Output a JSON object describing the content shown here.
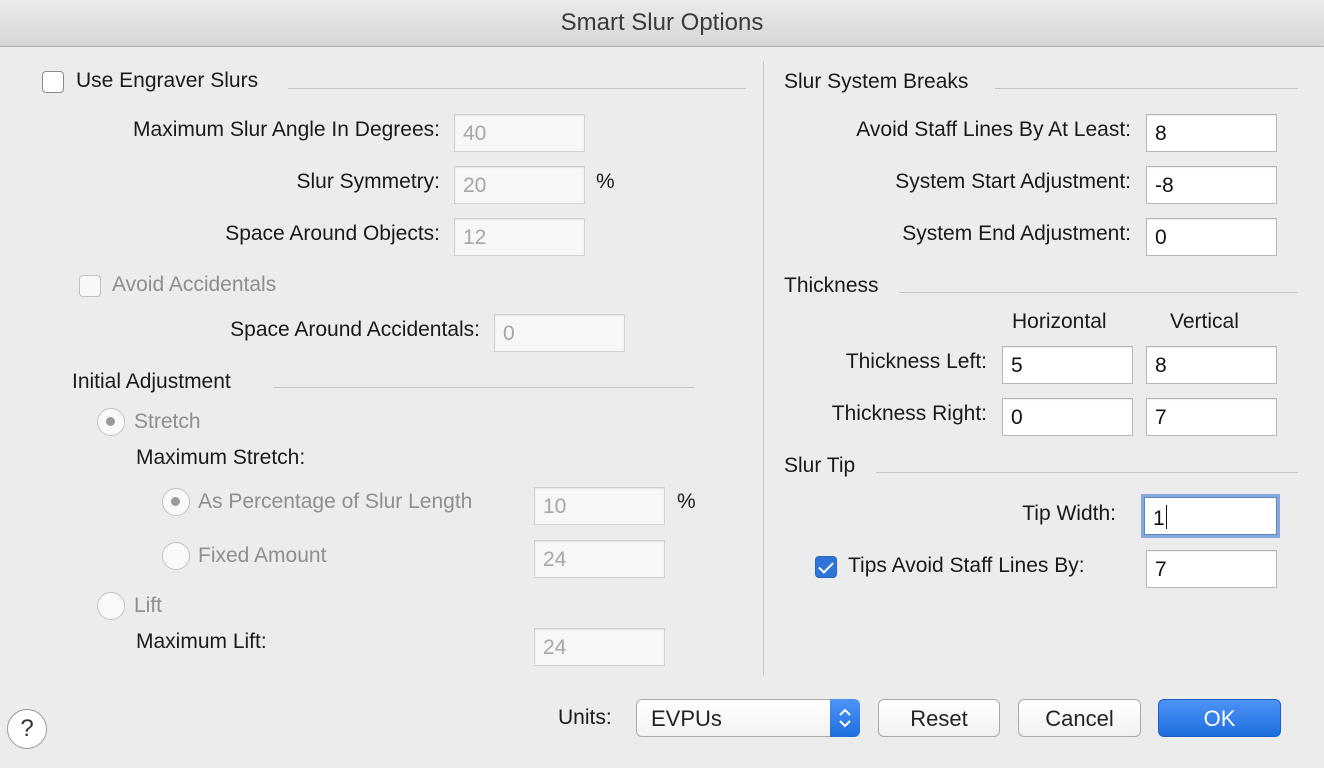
{
  "window": {
    "title": "Smart Slur Options"
  },
  "left": {
    "use_engraver": {
      "label": "Use Engraver Slurs",
      "checked": false
    },
    "max_angle": {
      "label": "Maximum Slur Angle In Degrees:",
      "value": "40"
    },
    "symmetry": {
      "label": "Slur Symmetry:",
      "value": "20",
      "unit": "%"
    },
    "space_objects": {
      "label": "Space Around Objects:",
      "value": "12"
    },
    "avoid_accidentals": {
      "label": "Avoid Accidentals",
      "checked": false
    },
    "space_accidentals": {
      "label": "Space Around Accidentals:",
      "value": "0"
    },
    "initial_adjustment": {
      "heading": "Initial Adjustment",
      "stretch": {
        "label": "Stretch",
        "selected": true
      },
      "max_stretch_label": "Maximum Stretch:",
      "as_percentage": {
        "label": "As Percentage of Slur Length",
        "value": "10",
        "unit": "%",
        "selected": true
      },
      "fixed_amount": {
        "label": "Fixed Amount",
        "value": "24",
        "selected": false
      },
      "lift": {
        "label": "Lift",
        "selected": false
      },
      "max_lift": {
        "label": "Maximum Lift:",
        "value": "24"
      }
    }
  },
  "right": {
    "system_breaks": {
      "heading": "Slur System Breaks",
      "avoid_staff": {
        "label": "Avoid Staff Lines By At Least:",
        "value": "8"
      },
      "start_adj": {
        "label": "System Start Adjustment:",
        "value": "-8"
      },
      "end_adj": {
        "label": "System End Adjustment:",
        "value": "0"
      }
    },
    "thickness": {
      "heading": "Thickness",
      "col_horizontal": "Horizontal",
      "col_vertical": "Vertical",
      "left": {
        "label": "Thickness Left:",
        "horizontal": "5",
        "vertical": "8"
      },
      "right": {
        "label": "Thickness Right:",
        "horizontal": "0",
        "vertical": "7"
      }
    },
    "slur_tip": {
      "heading": "Slur Tip",
      "tip_width": {
        "label": "Tip Width:",
        "value": "1"
      },
      "tips_avoid": {
        "label": "Tips Avoid Staff Lines By:",
        "value": "7",
        "checked": true
      }
    }
  },
  "footer": {
    "help": "?",
    "units_label": "Units:",
    "units_value": "EVPUs",
    "reset": "Reset",
    "cancel": "Cancel",
    "ok": "OK"
  },
  "colors": {
    "accent": "#2f74d9",
    "focus_ring": "#86a9da",
    "window_bg": "#ececec"
  },
  "icons": {
    "help": "help-icon",
    "checkmark": "checkmark-icon",
    "stepper": "chevron-up-down-icon"
  }
}
